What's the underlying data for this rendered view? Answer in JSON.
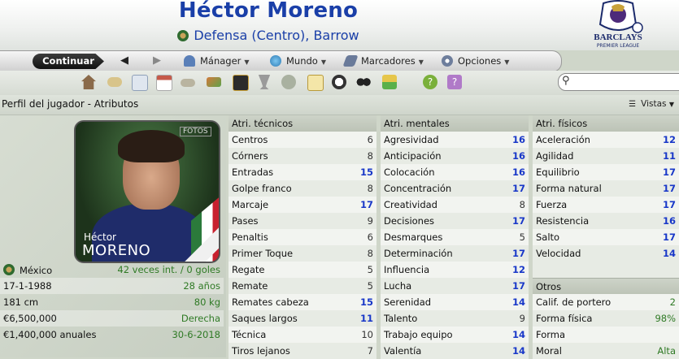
{
  "header": {
    "player_name": "Héctor Moreno",
    "subtitle": "Defensa (Centro), Barrow",
    "logo_line1": "BARCLAYS",
    "logo_line2": "PREMIER LEAGUE"
  },
  "menubar": {
    "continue": "Continuar",
    "back": "◀",
    "forward": "▶",
    "items": [
      {
        "label": "Mánager",
        "icon": "manager-icon",
        "color": "#5a7fb8"
      },
      {
        "label": "Mundo",
        "icon": "globe-icon",
        "color": "#3c8acb"
      },
      {
        "label": "Marcadores",
        "icon": "bookmark-icon",
        "color": "#6a7a9a"
      },
      {
        "label": "Opciones",
        "icon": "options-gear-icon",
        "color": "#6e7e9c"
      }
    ]
  },
  "toolbar": {
    "icons": [
      {
        "name": "home-icon",
        "color": "#8a6a4a"
      },
      {
        "name": "inbox-icon",
        "color": "#d8c48a"
      },
      {
        "name": "news-icon",
        "color": "#8fa0b8"
      },
      {
        "name": "calendar-icon",
        "color": "#c55a4a"
      },
      {
        "name": "squad-icon",
        "color": "#b9b4a0"
      },
      {
        "name": "transfers-icon",
        "color": "#d27a3c"
      },
      {
        "name": "tactics-icon",
        "color": "#2b2b2b"
      },
      {
        "name": "trophy-icon",
        "color": "#9a9a9a"
      },
      {
        "name": "training-icon",
        "color": "#a9b1a0"
      },
      {
        "name": "clipboard-icon",
        "color": "#e0c96a"
      },
      {
        "name": "match-icon",
        "color": "#4a4a4a"
      },
      {
        "name": "binoculars-icon",
        "color": "#2a2a2a"
      },
      {
        "name": "finances-icon",
        "color": "#e6c64a"
      },
      {
        "name": "help-icon",
        "color": "#7ab03a"
      },
      {
        "name": "help2-icon",
        "color": "#b07ac8"
      }
    ],
    "search_placeholder": ""
  },
  "page": {
    "title": "Perfil del jugador - Atributos",
    "views": "Vistas"
  },
  "photo": {
    "first_name": "Héctor",
    "last_name": "MORENO",
    "tag": "FOTOS"
  },
  "info": [
    {
      "label": "México",
      "value": "42 veces int. / 0 goles"
    },
    {
      "label": "17-1-1988",
      "value": "28 años"
    },
    {
      "label": "181 cm",
      "value": "80 kg"
    },
    {
      "label": "€6,500,000",
      "value": "Derecha"
    },
    {
      "label": "€1,400,000 anuales",
      "value": "30-6-2018"
    }
  ],
  "columns": {
    "tecnicos": {
      "header": "Atri. técnicos",
      "rows": [
        {
          "name": "Centros",
          "value": "6"
        },
        {
          "name": "Córners",
          "value": "8"
        },
        {
          "name": "Entradas",
          "value": "15"
        },
        {
          "name": "Golpe franco",
          "value": "8"
        },
        {
          "name": "Marcaje",
          "value": "17"
        },
        {
          "name": "Pases",
          "value": "9"
        },
        {
          "name": "Penaltis",
          "value": "6"
        },
        {
          "name": "Primer Toque",
          "value": "8"
        },
        {
          "name": "Regate",
          "value": "5"
        },
        {
          "name": "Remate",
          "value": "5"
        },
        {
          "name": "Remates cabeza",
          "value": "15"
        },
        {
          "name": "Saques largos",
          "value": "11"
        },
        {
          "name": "Técnica",
          "value": "10"
        },
        {
          "name": "Tiros lejanos",
          "value": "7"
        }
      ]
    },
    "mentales": {
      "header": "Atri. mentales",
      "rows": [
        {
          "name": "Agresividad",
          "value": "16"
        },
        {
          "name": "Anticipación",
          "value": "16"
        },
        {
          "name": "Colocación",
          "value": "16"
        },
        {
          "name": "Concentración",
          "value": "17"
        },
        {
          "name": "Creatividad",
          "value": "8"
        },
        {
          "name": "Decisiones",
          "value": "17"
        },
        {
          "name": "Desmarques",
          "value": "5"
        },
        {
          "name": "Determinación",
          "value": "17"
        },
        {
          "name": "Influencia",
          "value": "12"
        },
        {
          "name": "Lucha",
          "value": "17"
        },
        {
          "name": "Serenidad",
          "value": "14"
        },
        {
          "name": "Talento",
          "value": "9"
        },
        {
          "name": "Trabajo equipo",
          "value": "14"
        },
        {
          "name": "Valentía",
          "value": "14"
        }
      ]
    },
    "fisicos": {
      "header": "Atri. físicos",
      "rows": [
        {
          "name": "Aceleración",
          "value": "12"
        },
        {
          "name": "Agilidad",
          "value": "11"
        },
        {
          "name": "Equilibrio",
          "value": "17"
        },
        {
          "name": "Forma natural",
          "value": "17"
        },
        {
          "name": "Fuerza",
          "value": "17"
        },
        {
          "name": "Resistencia",
          "value": "16"
        },
        {
          "name": "Salto",
          "value": "17"
        },
        {
          "name": "Velocidad",
          "value": "14"
        }
      ]
    },
    "otros": {
      "header": "Otros",
      "rows": [
        {
          "name": "Calif. de portero",
          "value": "2"
        },
        {
          "name": "Forma física",
          "value": "98%"
        },
        {
          "name": "Forma",
          "value": ""
        },
        {
          "name": "Moral",
          "value": "Alta"
        }
      ]
    }
  }
}
